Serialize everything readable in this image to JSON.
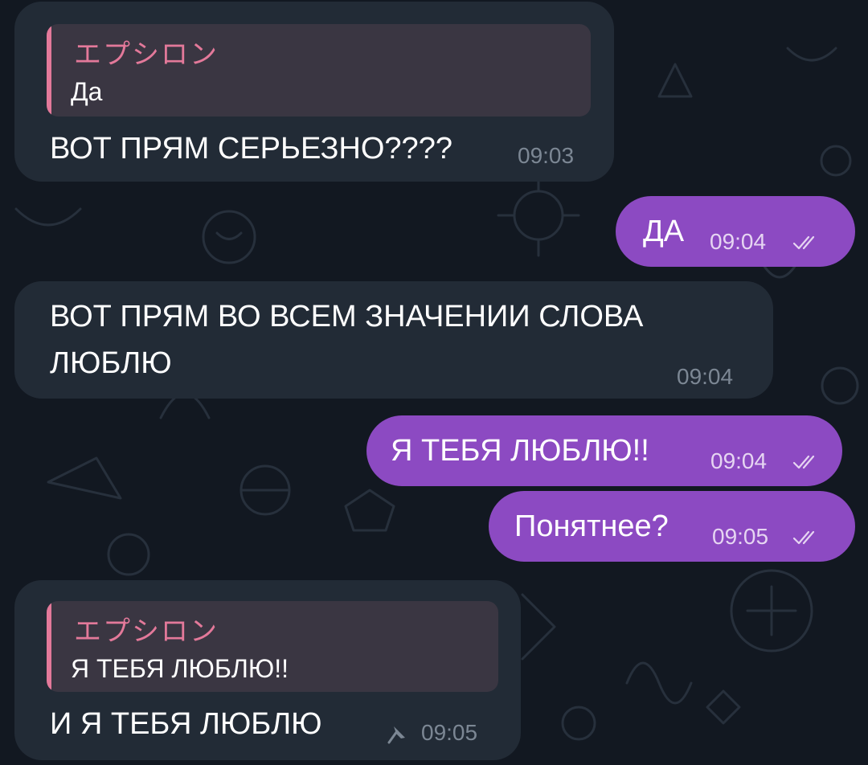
{
  "messages": [
    {
      "direction": "incoming",
      "reply": {
        "author": "エプシロン",
        "text": "Да"
      },
      "text": "ВОТ ПРЯМ СЕРЬЕЗНО????",
      "time": "09:03"
    },
    {
      "direction": "outgoing",
      "text": "ДА",
      "time": "09:04",
      "status_icon": "double-check-icon"
    },
    {
      "direction": "incoming",
      "text_lines": [
        "ВОТ ПРЯМ ВО ВСЕМ ЗНАЧЕНИИ СЛОВА",
        "ЛЮБЛЮ"
      ],
      "time": "09:04"
    },
    {
      "direction": "outgoing",
      "text": "Я ТЕБЯ ЛЮБЛЮ!!",
      "time": "09:04",
      "status_icon": "double-check-icon"
    },
    {
      "direction": "outgoing",
      "text": "Понятнее?",
      "time": "09:05",
      "status_icon": "double-check-icon"
    },
    {
      "direction": "incoming",
      "reply": {
        "author": "エプシロン",
        "text": "Я ТЕБЯ ЛЮБЛЮ!!"
      },
      "text": "И Я ТЕБЯ ЛЮБЛЮ",
      "time": "09:05",
      "pinned": true,
      "status_icon": "pin-icon"
    }
  ],
  "colors": {
    "background": "#121821",
    "incoming_bubble": "#222b36",
    "outgoing_bubble": "#8c4ac2",
    "reply_accent": "#e3799a",
    "reply_block": "#3a3642"
  }
}
